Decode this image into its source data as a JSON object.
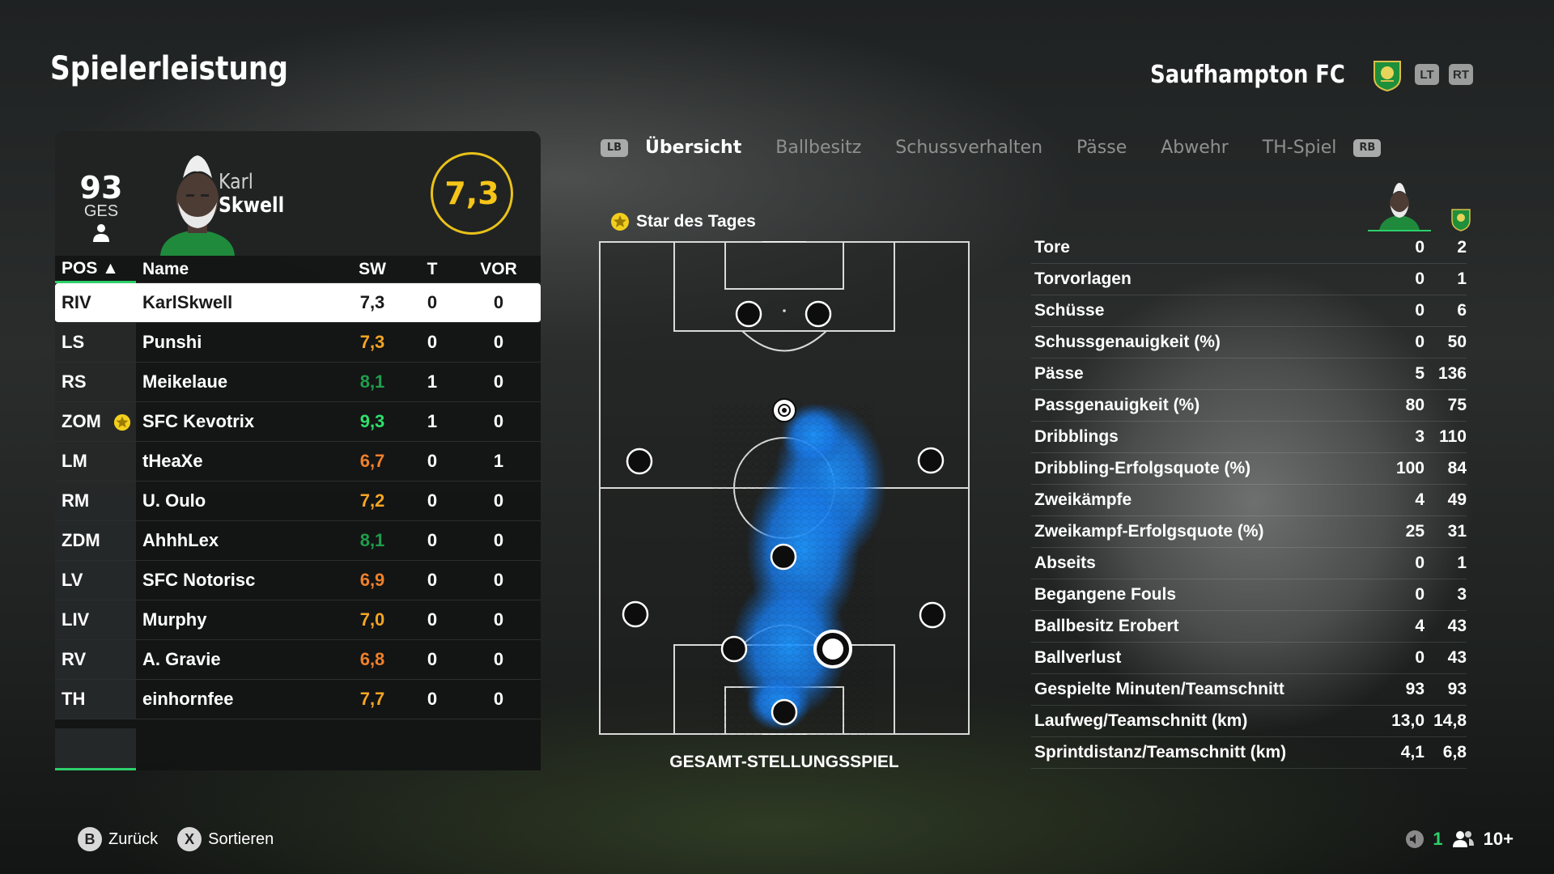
{
  "page_title": "Spielerleistung",
  "team": {
    "name": "Saufhampton FC",
    "lt": "LT",
    "rt": "RT"
  },
  "player": {
    "overall": "93",
    "overall_label": "GES",
    "first_name": "Karl",
    "last_name": "Skwell",
    "rating": "7,3"
  },
  "table": {
    "headers": {
      "pos": "POS ▲",
      "name": "Name",
      "sw": "SW",
      "t": "T",
      "vor": "VOR"
    },
    "rows": [
      {
        "pos": "RIV",
        "name": "KarlSkwell",
        "sw": "7,3",
        "t": "0",
        "vor": "0",
        "color": "#1a1a1a",
        "selected": true
      },
      {
        "pos": "LS",
        "name": "Punshi",
        "sw": "7,3",
        "t": "0",
        "vor": "0",
        "color": "#f5a623"
      },
      {
        "pos": "RS",
        "name": "Meikelaue",
        "sw": "8,1",
        "t": "1",
        "vor": "0",
        "color": "#1e9e4c"
      },
      {
        "pos": "ZOM",
        "name": "SFC Kevotrix",
        "sw": "9,3",
        "t": "1",
        "vor": "0",
        "color": "#2ee06c",
        "star": true
      },
      {
        "pos": "LM",
        "name": "tHeaXe",
        "sw": "6,7",
        "t": "0",
        "vor": "1",
        "color": "#f0802a"
      },
      {
        "pos": "RM",
        "name": "U. Oulo",
        "sw": "7,2",
        "t": "0",
        "vor": "0",
        "color": "#f5a623"
      },
      {
        "pos": "ZDM",
        "name": "AhhhLex",
        "sw": "8,1",
        "t": "0",
        "vor": "0",
        "color": "#1e9e4c"
      },
      {
        "pos": "LV",
        "name": "SFC Notorisc",
        "sw": "6,9",
        "t": "0",
        "vor": "0",
        "color": "#f0802a"
      },
      {
        "pos": "LIV",
        "name": "Murphy",
        "sw": "7,0",
        "t": "0",
        "vor": "0",
        "color": "#f5a623"
      },
      {
        "pos": "RV",
        "name": "A. Gravie",
        "sw": "6,8",
        "t": "0",
        "vor": "0",
        "color": "#f0802a"
      },
      {
        "pos": "TH",
        "name": "einhornfee",
        "sw": "7,7",
        "t": "0",
        "vor": "0",
        "color": "#f5a623"
      }
    ]
  },
  "tabs": {
    "lb": "LB",
    "rb": "RB",
    "items": [
      "Übersicht",
      "Ballbesitz",
      "Schussverhalten",
      "Pässe",
      "Abwehr",
      "TH-Spiel"
    ],
    "active": 0
  },
  "star_of_day": "Star des Tages",
  "pitch_label": "GESAMT-STELLUNGSSPIEL",
  "stats": [
    {
      "label": "Tore",
      "player": "0",
      "team": "2"
    },
    {
      "label": "Torvorlagen",
      "player": "0",
      "team": "1"
    },
    {
      "label": "Schüsse",
      "player": "0",
      "team": "6"
    },
    {
      "label": "Schussgenauigkeit (%)",
      "player": "0",
      "team": "50"
    },
    {
      "label": "Pässe",
      "player": "5",
      "team": "136"
    },
    {
      "label": "Passgenauigkeit (%)",
      "player": "80",
      "team": "75"
    },
    {
      "label": "Dribblings",
      "player": "3",
      "team": "110"
    },
    {
      "label": "Dribbling-Erfolgsquote (%)",
      "player": "100",
      "team": "84"
    },
    {
      "label": "Zweikämpfe",
      "player": "4",
      "team": "49"
    },
    {
      "label": "Zweikampf-Erfolgsquote (%)",
      "player": "25",
      "team": "31"
    },
    {
      "label": "Abseits",
      "player": "0",
      "team": "1"
    },
    {
      "label": "Begangene Fouls",
      "player": "0",
      "team": "3"
    },
    {
      "label": "Ballbesitz Erobert",
      "player": "4",
      "team": "43"
    },
    {
      "label": "Ballverlust",
      "player": "0",
      "team": "43"
    },
    {
      "label": "Gespielte Minuten/Teamschnitt",
      "player": "93",
      "team": "93"
    },
    {
      "label": "Laufweg/Teamschnitt (km)",
      "player": "13,0",
      "team": "14,8"
    },
    {
      "label": "Sprintdistanz/Teamschnitt (km)",
      "player": "4,1",
      "team": "6,8"
    }
  ],
  "footer": {
    "back_btn": "B",
    "back_label": "Zurück",
    "sort_btn": "X",
    "sort_label": "Sortieren",
    "mic_count": "1",
    "party_count": "10+"
  },
  "colors": {
    "accent_green": "#2ecf6a",
    "rating_yellow": "#f5c518",
    "heatmap_blue": "#1e90ff"
  }
}
